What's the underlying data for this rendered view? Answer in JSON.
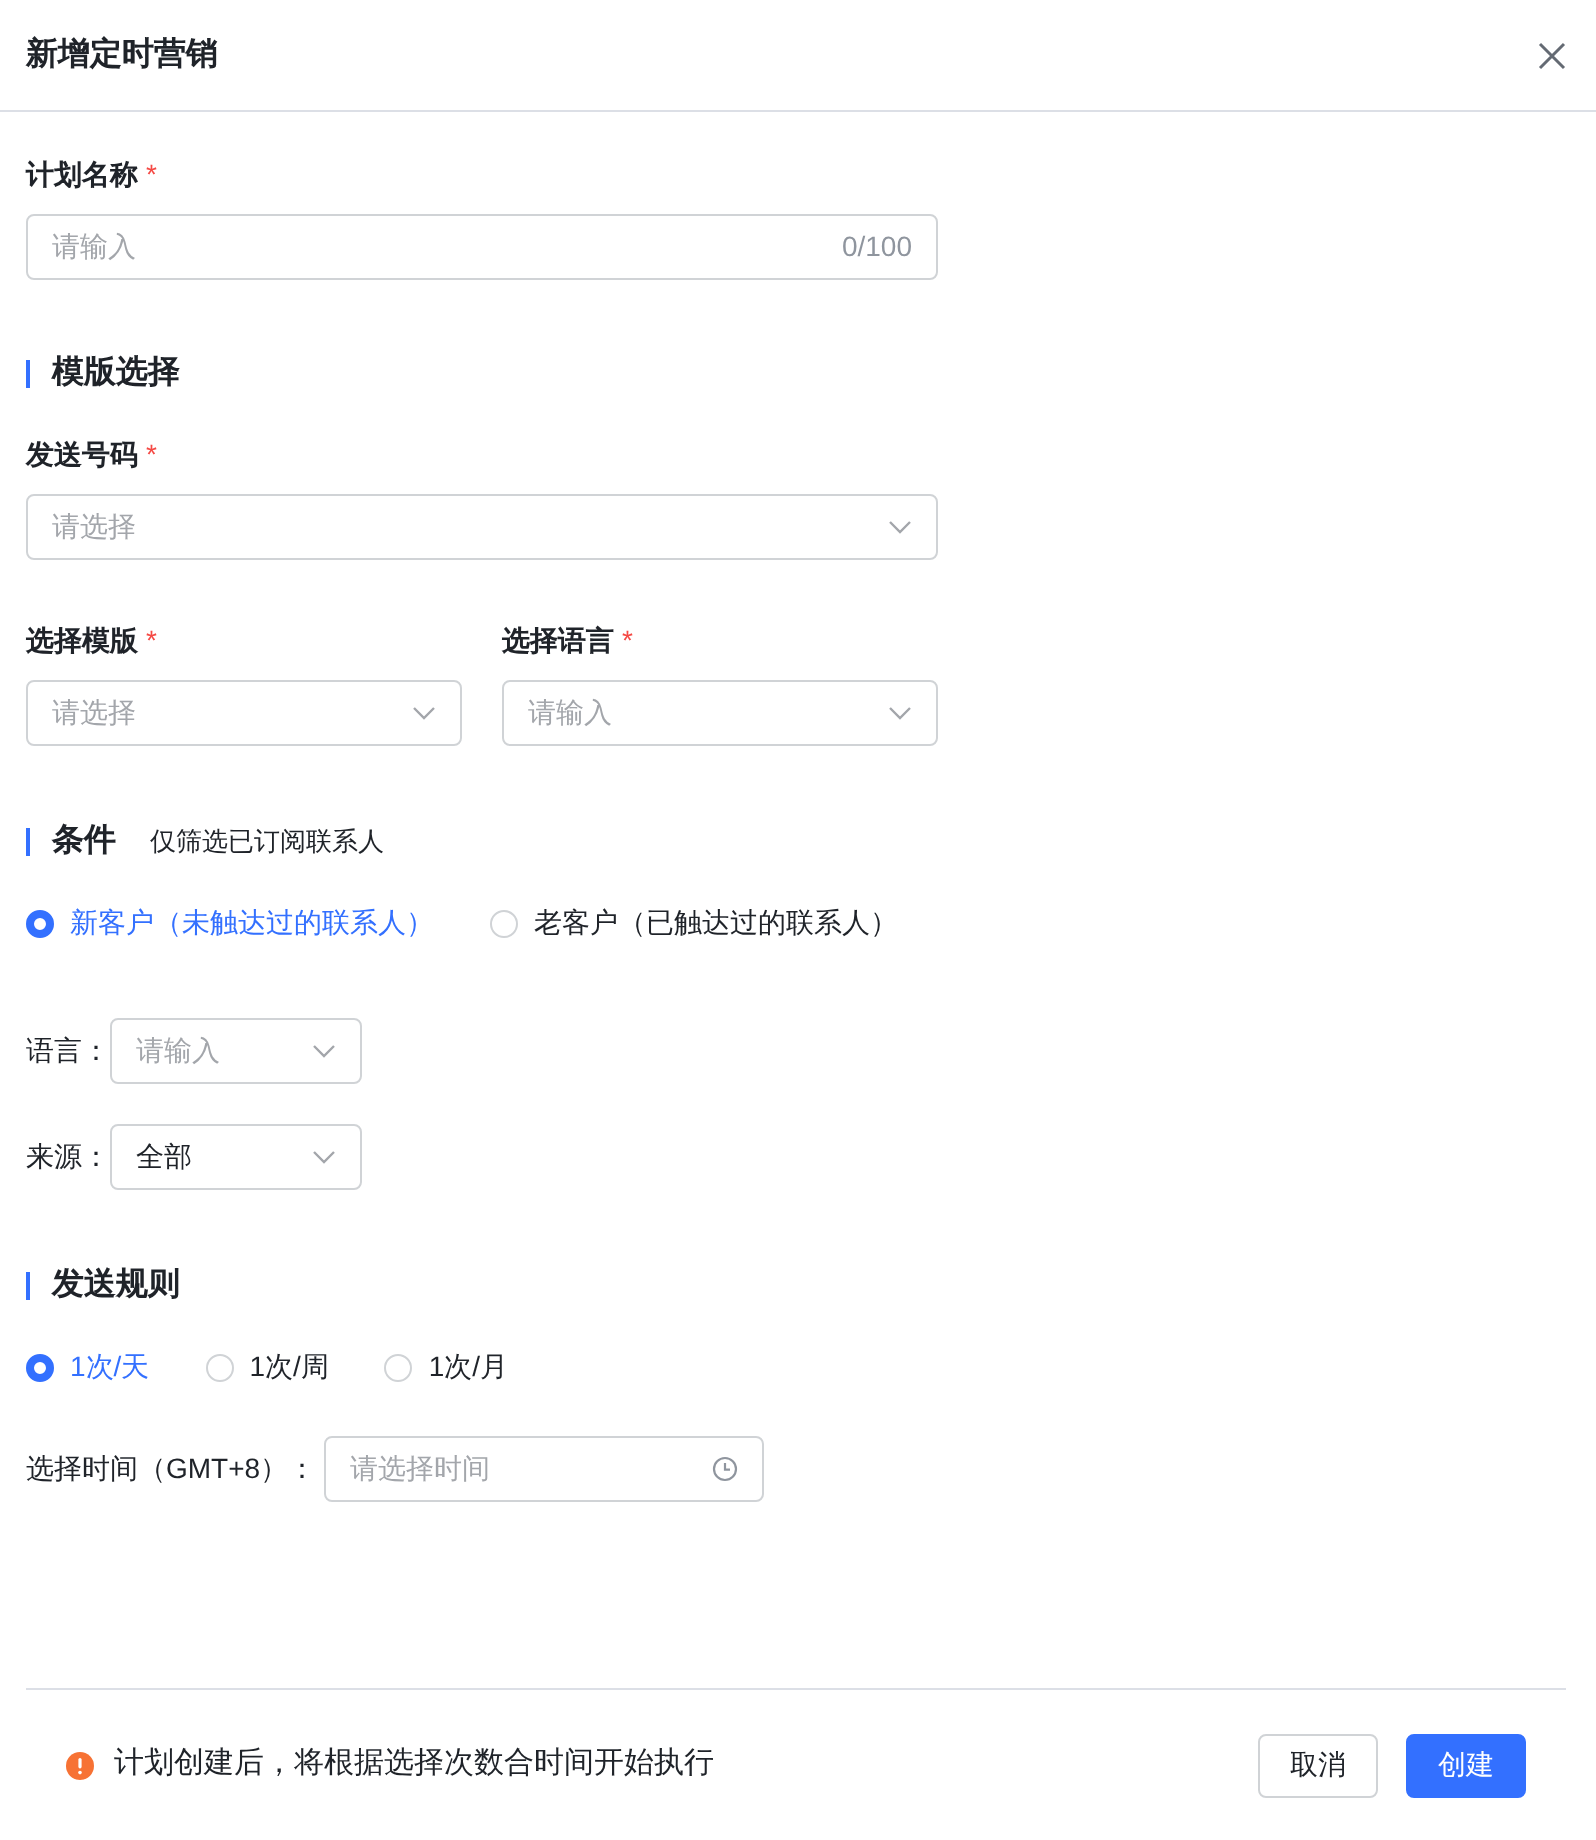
{
  "title": "新增定时营销",
  "plan_name": {
    "label": "计划名称",
    "required_mark": "*",
    "placeholder": "请输入",
    "counter": "0/100"
  },
  "template_section": {
    "heading": "模版选择",
    "fields": [
      {
        "label": "发送号码",
        "required_mark": "*",
        "placeholder": "请选择"
      },
      {
        "label": "选择模版",
        "required_mark": "*",
        "placeholder": "请选择"
      },
      {
        "label": "选择语言",
        "required_mark": "*",
        "placeholder": "请输入"
      }
    ]
  },
  "condition_section": {
    "heading": "条件",
    "note": "仅筛选已订阅联系人",
    "options": [
      {
        "label": "新客户（未触达过的联系人）",
        "selected": true
      },
      {
        "label": "老客户（已触达过的联系人）",
        "selected": false
      }
    ],
    "filters": [
      {
        "label": "语言：",
        "placeholder": "请输入"
      },
      {
        "label": "来源：",
        "value": "全部"
      }
    ]
  },
  "rule_section": {
    "heading": "发送规则",
    "options": [
      {
        "label": "1次/天",
        "selected": true
      },
      {
        "label": "1次/周",
        "selected": false
      },
      {
        "label": "1次/月",
        "selected": false
      }
    ],
    "time": {
      "label": "选择时间（GMT+8）：",
      "placeholder": "请选择时间"
    }
  },
  "footer": {
    "notice": "计划创建后，将根据选择次数合时间开始执行",
    "buttons": [
      {
        "label": "取消",
        "kind": "secondary"
      },
      {
        "label": "创建",
        "kind": "primary"
      }
    ]
  }
}
